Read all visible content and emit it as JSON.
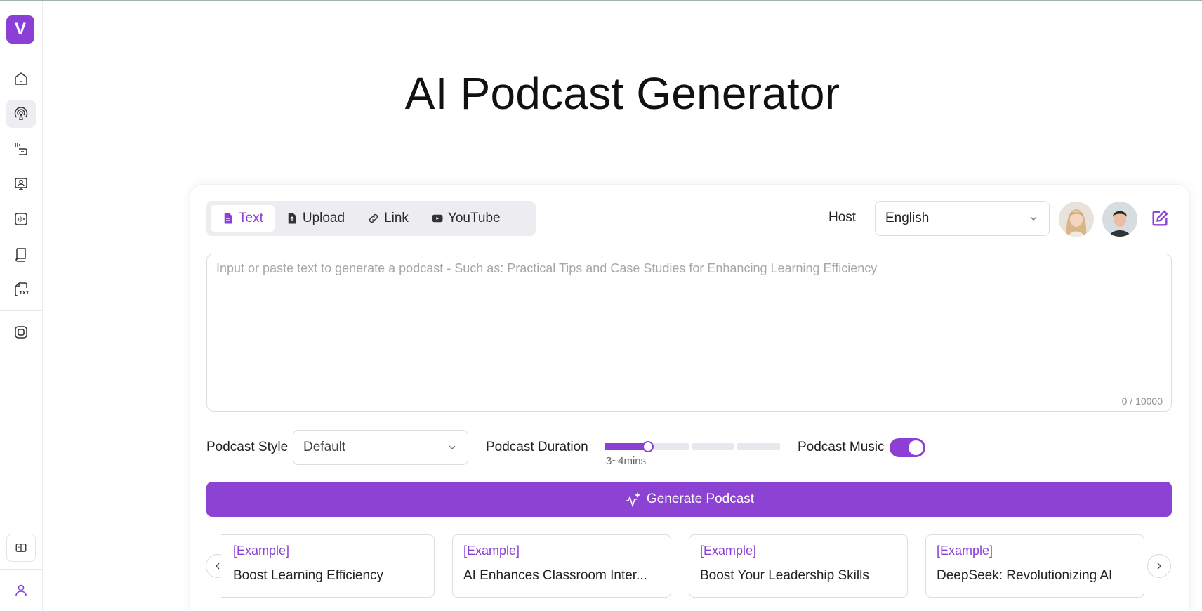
{
  "app": {
    "logo_letter": "V",
    "brand_color": "#8b3fd6"
  },
  "sidebar": {
    "items": [
      {
        "name": "home",
        "icon": "home-icon",
        "active": false
      },
      {
        "name": "podcast",
        "icon": "podcast-icon",
        "active": true
      },
      {
        "name": "voice",
        "icon": "voice-tap-icon",
        "active": false
      },
      {
        "name": "avatar",
        "icon": "presenter-icon",
        "active": false
      },
      {
        "name": "audio",
        "icon": "waveform-icon",
        "active": false
      },
      {
        "name": "book",
        "icon": "book-icon",
        "active": false
      },
      {
        "name": "txt",
        "icon": "txt-file-icon",
        "active": false
      },
      {
        "name": "image",
        "icon": "image-icon",
        "active": false
      }
    ],
    "bottom_icons": [
      "collapse-sidebar-icon",
      "user-icon"
    ]
  },
  "page": {
    "title": "AI Podcast Generator"
  },
  "input_tabs": [
    {
      "label": "Text",
      "icon": "document-icon",
      "active": true
    },
    {
      "label": "Upload",
      "icon": "upload-icon",
      "active": false
    },
    {
      "label": "Link",
      "icon": "link-icon",
      "active": false
    },
    {
      "label": "YouTube",
      "icon": "youtube-icon",
      "active": false
    }
  ],
  "host": {
    "label": "Host",
    "language": "English",
    "avatars": [
      "host-female-avatar",
      "host-male-avatar"
    ]
  },
  "textarea": {
    "placeholder": "Input or paste text to generate a podcast - Such as: Practical Tips and Case Studies for Enhancing Learning Efficiency",
    "value": "",
    "counter": "0 / 10000"
  },
  "options": {
    "style_label": "Podcast Style",
    "style_value": "Default",
    "duration_label": "Podcast Duration",
    "duration_caption": "3~4mins",
    "duration_step": 1,
    "duration_steps_total": 4,
    "music_label": "Podcast Music",
    "music_on": true
  },
  "generate_button": {
    "label": "Generate Podcast"
  },
  "examples": [
    {
      "tag": "[Example]",
      "title": "Boost Learning Efficiency"
    },
    {
      "tag": "[Example]",
      "title": "AI Enhances Classroom Inter..."
    },
    {
      "tag": "[Example]",
      "title": "Boost Your Leadership Skills"
    },
    {
      "tag": "[Example]",
      "title": "DeepSeek: Revolutionizing AI"
    }
  ]
}
